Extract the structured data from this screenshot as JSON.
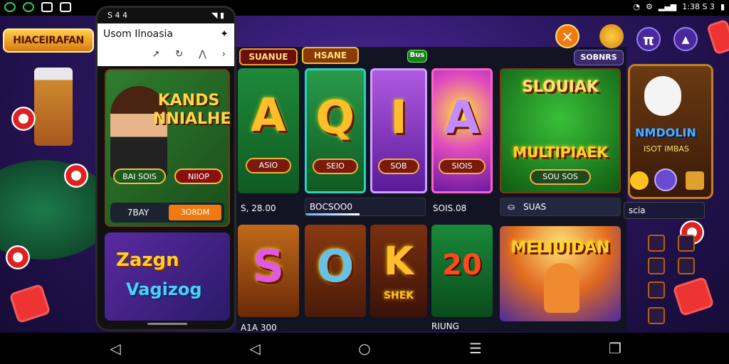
{
  "status_bar": {
    "left_icons": [
      "wifi-hotspot-icon",
      "whatsapp-icon",
      "gallery-icon",
      "keyboard-icon"
    ],
    "right_text": "1:38 S 3",
    "right_icons": [
      "wifi-icon",
      "settings-icon",
      "signal-icon",
      "battery-icon"
    ]
  },
  "background": {
    "logo_left": "HIACEIRAFAN"
  },
  "phone": {
    "status_left": "S 4 4",
    "header_title": "Usom Ilnoasia",
    "card1": {
      "title": "KANDS NNIALHE",
      "btn_left": "BAI SOIS",
      "btn_right": "NIIOP",
      "bar_left": "7BAY",
      "bar_right": "3O8DM"
    },
    "card2": {
      "line1": "Zazgn",
      "line2": "Vagizog"
    }
  },
  "main": {
    "tabs": [
      "SUANUE",
      "HSANE"
    ],
    "badge": "Bus",
    "top_right_label": "SOBNRS",
    "tiles_row1": [
      {
        "letter": "A",
        "button": "ASIO"
      },
      {
        "letter": "Q",
        "button": "SEIO"
      },
      {
        "letter": "I",
        "button": "SOB"
      },
      {
        "letter": "A",
        "button": "SIOIS"
      }
    ],
    "feature_tile": {
      "title": "SLOUIAK",
      "subtitle": "MULTIPIAEK",
      "button": "SOU SOS",
      "footer": "SUAS"
    },
    "row1_values": {
      "left": "S, 28.00",
      "progress_label": "BOCSOO0",
      "progress": 0.45,
      "right": "SOIS.08"
    },
    "tiles_row2": [
      {
        "letter": "S"
      },
      {
        "letter": "O"
      },
      {
        "letter": "K",
        "caption": "SHEK"
      },
      {
        "letter": "20"
      }
    ],
    "feature2_title": "MELIUIDAN",
    "row2_values": {
      "left": "A1A 300",
      "right": "RIUNG"
    }
  },
  "right_panel": {
    "close_icon": "close-icon",
    "coin_icon": "coin-icon",
    "pi_label": "π",
    "up_label": "▲",
    "card_title": "NMDOLIN",
    "card_sub": "ISOT IMBAS",
    "field_label": "scia"
  },
  "nav": {
    "icons": [
      "back-icon",
      "back-icon",
      "home-icon",
      "menu-icon",
      "recents-icon"
    ]
  },
  "colors": {
    "accent": "#f07a10",
    "gold": "#ffbf2a",
    "panel": "#121424"
  }
}
